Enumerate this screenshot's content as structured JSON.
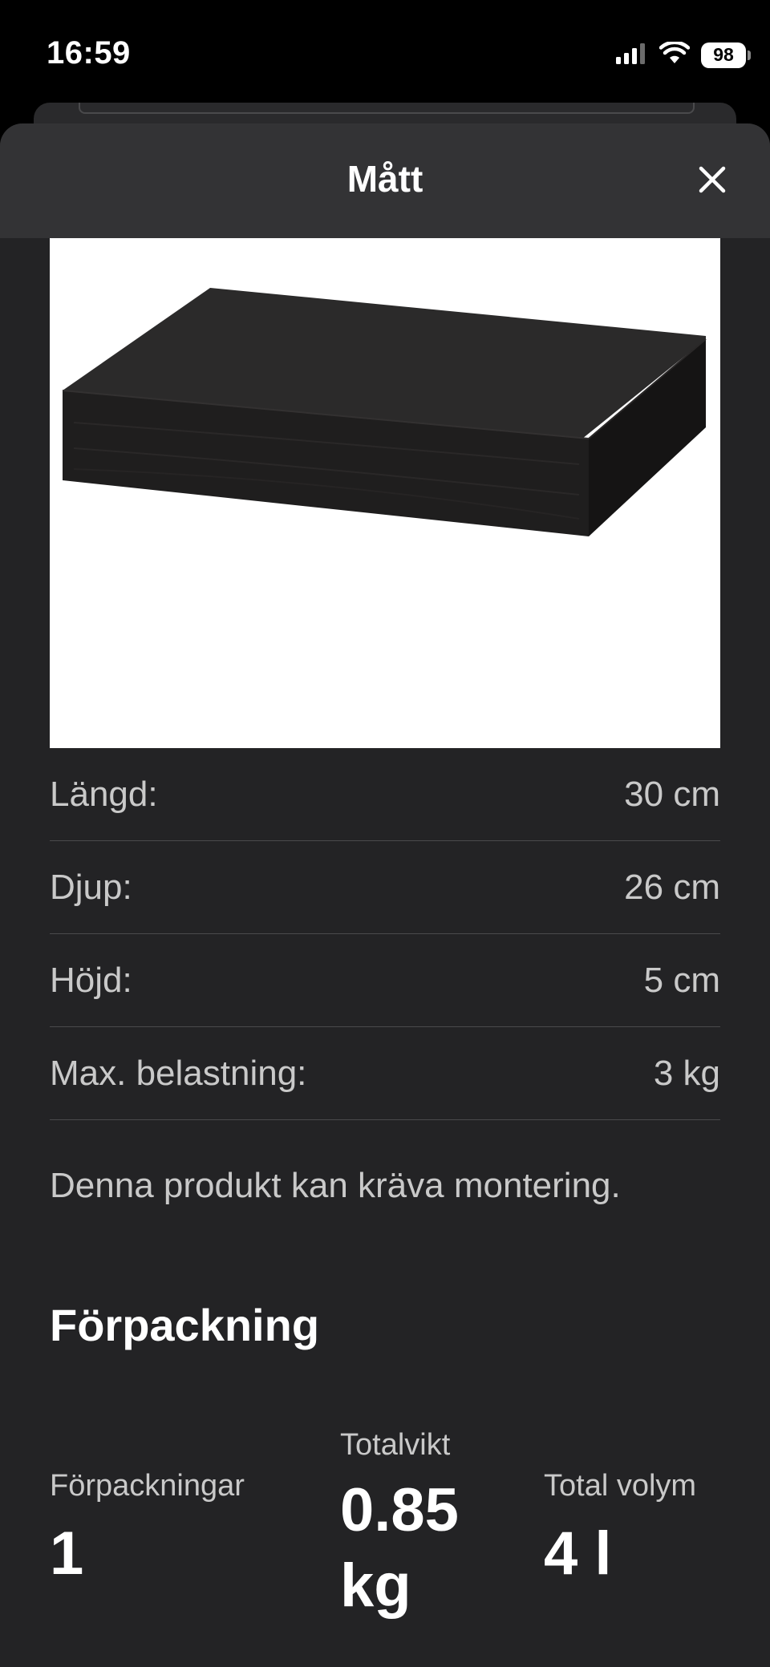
{
  "status_bar": {
    "time": "16:59",
    "battery": "98",
    "icons": [
      "signal-icon",
      "wifi-icon",
      "battery-icon"
    ]
  },
  "sheet": {
    "title": "Mått",
    "close_icon": "close-icon"
  },
  "dimensions": [
    {
      "label": "Längd:",
      "value": "30 cm"
    },
    {
      "label": "Djup:",
      "value": "26 cm"
    },
    {
      "label": "Höjd:",
      "value": "5 cm"
    },
    {
      "label": "Max. belastning:",
      "value": "3 kg"
    }
  ],
  "note": "Denna produkt kan kräva montering.",
  "packaging": {
    "title": "Förpackning",
    "count_label": "Förpackningar",
    "count_value": "1",
    "weight_label": "Totalvikt",
    "weight_value_line1": "0.85",
    "weight_value_line2": "kg",
    "volume_label": "Total volym",
    "volume_value": "4 l"
  },
  "colors": {
    "background": "#000000",
    "sheet": "#232325",
    "header": "#333335",
    "text": "#c9c9c9",
    "heading": "#ffffff"
  }
}
